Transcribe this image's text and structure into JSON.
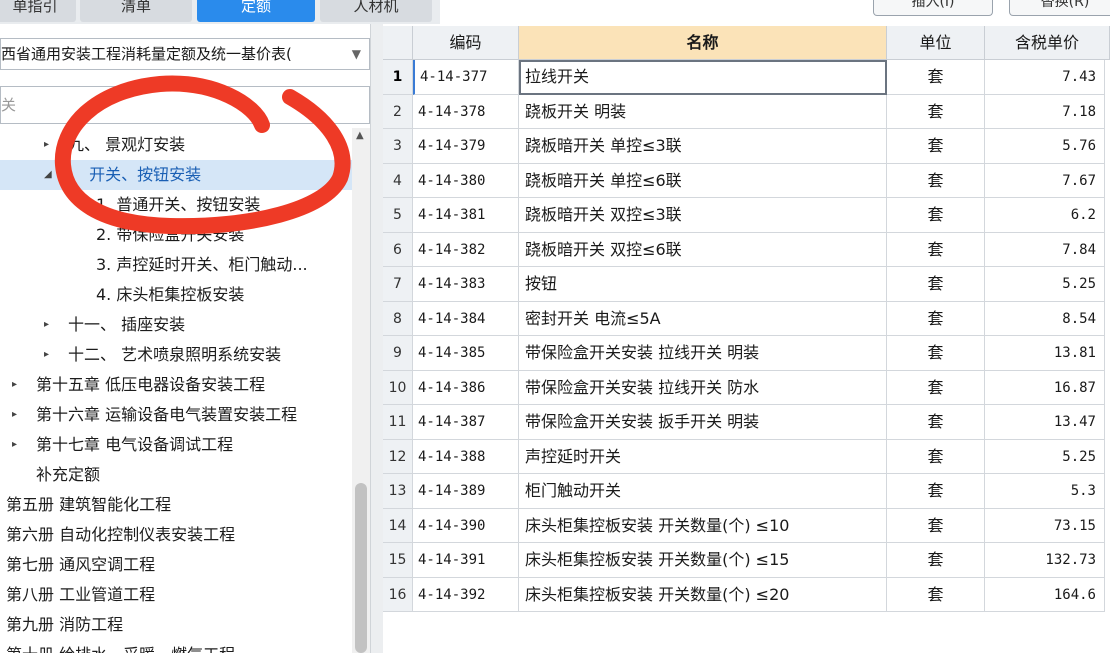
{
  "tabs": [
    {
      "label": "单指引",
      "active": false
    },
    {
      "label": "清单",
      "active": false
    },
    {
      "label": "定额",
      "active": true
    },
    {
      "label": "人材机",
      "active": false
    }
  ],
  "top_buttons": {
    "insert": "插入(I)",
    "replace": "替换(R)"
  },
  "left": {
    "library": "西省通用安装工程消耗量定额及统一基价表(",
    "search_value": "关",
    "tree": [
      {
        "label": "九、 景观灯安装",
        "arrow": "▸"
      },
      {
        "label": "、 开关、按钮安装",
        "arrow": "◢",
        "selected": true
      },
      {
        "label": "1. 普通开关、按钮安装",
        "arrow": ""
      },
      {
        "label": "2. 带保险盒开关安装",
        "arrow": ""
      },
      {
        "label": "3. 声控延时开关、柜门触动...",
        "arrow": ""
      },
      {
        "label": "4. 床头柜集控板安装",
        "arrow": ""
      },
      {
        "label": "十一、 插座安装",
        "arrow": "▸"
      },
      {
        "label": "十二、 艺术喷泉照明系统安装",
        "arrow": "▸"
      },
      {
        "label": "第十五章 低压电器设备安装工程",
        "arrow": "▸"
      },
      {
        "label": "第十六章 运输设备电气装置安装工程",
        "arrow": "▸"
      },
      {
        "label": "第十七章 电气设备调试工程",
        "arrow": "▸"
      },
      {
        "label": "补充定额",
        "arrow": ""
      },
      {
        "label": "第五册 建筑智能化工程",
        "arrow": ""
      },
      {
        "label": "第六册 自动化控制仪表安装工程",
        "arrow": ""
      },
      {
        "label": "第七册 通风空调工程",
        "arrow": ""
      },
      {
        "label": "第八册 工业管道工程",
        "arrow": ""
      },
      {
        "label": "第九册 消防工程",
        "arrow": ""
      },
      {
        "label": "第十册 给排水、采暖、燃气工程",
        "arrow": ""
      }
    ]
  },
  "grid": {
    "headers": {
      "code": "编码",
      "name": "名称",
      "unit": "单位",
      "price": "含税单价"
    },
    "rows": [
      {
        "idx": "1",
        "code": "4-14-377",
        "name": "拉线开关",
        "unit": "套",
        "price": "7.43"
      },
      {
        "idx": "2",
        "code": "4-14-378",
        "name": "跷板开关 明装",
        "unit": "套",
        "price": "7.18"
      },
      {
        "idx": "3",
        "code": "4-14-379",
        "name": "跷板暗开关 单控≤3联",
        "unit": "套",
        "price": "5.76"
      },
      {
        "idx": "4",
        "code": "4-14-380",
        "name": "跷板暗开关 单控≤6联",
        "unit": "套",
        "price": "7.67"
      },
      {
        "idx": "5",
        "code": "4-14-381",
        "name": "跷板暗开关 双控≤3联",
        "unit": "套",
        "price": "6.2"
      },
      {
        "idx": "6",
        "code": "4-14-382",
        "name": "跷板暗开关 双控≤6联",
        "unit": "套",
        "price": "7.84"
      },
      {
        "idx": "7",
        "code": "4-14-383",
        "name": "按钮",
        "unit": "套",
        "price": "5.25"
      },
      {
        "idx": "8",
        "code": "4-14-384",
        "name": "密封开关 电流≤5A",
        "unit": "套",
        "price": "8.54"
      },
      {
        "idx": "9",
        "code": "4-14-385",
        "name": "带保险盒开关安装 拉线开关 明装",
        "unit": "套",
        "price": "13.81"
      },
      {
        "idx": "10",
        "code": "4-14-386",
        "name": "带保险盒开关安装 拉线开关 防水",
        "unit": "套",
        "price": "16.87"
      },
      {
        "idx": "11",
        "code": "4-14-387",
        "name": "带保险盒开关安装 扳手开关 明装",
        "unit": "套",
        "price": "13.47"
      },
      {
        "idx": "12",
        "code": "4-14-388",
        "name": "声控延时开关",
        "unit": "套",
        "price": "5.25"
      },
      {
        "idx": "13",
        "code": "4-14-389",
        "name": "柜门触动开关",
        "unit": "套",
        "price": "5.3"
      },
      {
        "idx": "14",
        "code": "4-14-390",
        "name": "床头柜集控板安装 开关数量(个) ≤10",
        "unit": "套",
        "price": "73.15"
      },
      {
        "idx": "15",
        "code": "4-14-391",
        "name": "床头柜集控板安装 开关数量(个) ≤15",
        "unit": "套",
        "price": "132.73"
      },
      {
        "idx": "16",
        "code": "4-14-392",
        "name": "床头柜集控板安装 开关数量(个) ≤20",
        "unit": "套",
        "price": "164.6"
      }
    ]
  },
  "colors": {
    "accent": "#2a8bec",
    "header_highlight": "#fbe3b8",
    "annotation": "#ee3a26"
  }
}
